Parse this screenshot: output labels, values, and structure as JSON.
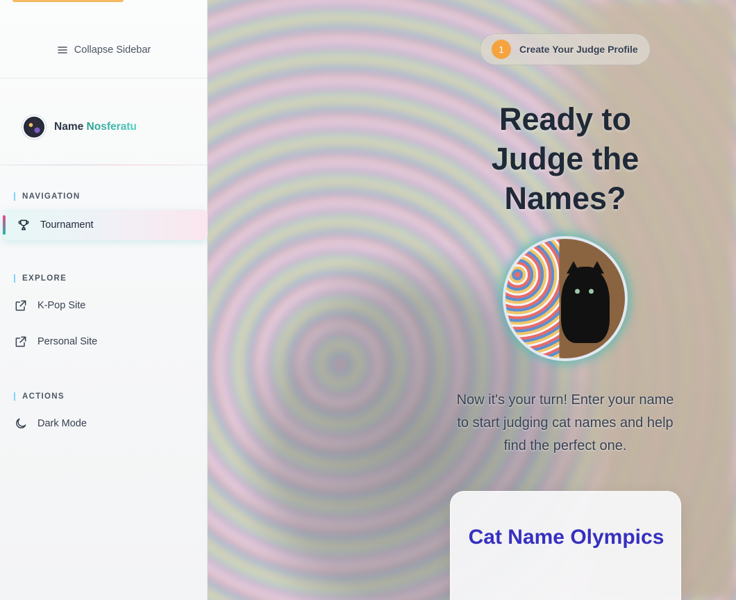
{
  "sidebar": {
    "collapse_label": "Collapse Sidebar",
    "profile": {
      "prefix": "Name",
      "username": "Nosferatu"
    },
    "sections": {
      "navigation": "NAVIGATION",
      "explore": "EXPLORE",
      "actions": "ACTIONS"
    },
    "items": {
      "tournament": "Tournament",
      "kpop": "K-Pop Site",
      "personal": "Personal Site",
      "dark_mode": "Dark Mode"
    },
    "icons": {
      "collapse": "menu-icon",
      "tournament": "trophy-icon",
      "kpop": "external-link-icon",
      "personal": "external-link-icon",
      "dark_mode": "moon-icon"
    }
  },
  "main": {
    "step": {
      "number": "1",
      "label": "Create Your Judge Profile"
    },
    "title": "Ready to Judge the Names?",
    "description": "Now it's your turn! Enter your name to start judging cat names and help find the perfect one.",
    "card_title": "Cat Name Olympics"
  },
  "colors": {
    "accent_orange": "#f5a340",
    "accent_teal": "#2aa89f",
    "card_title": "#3730c0",
    "active_indicator": "#e9458c"
  }
}
